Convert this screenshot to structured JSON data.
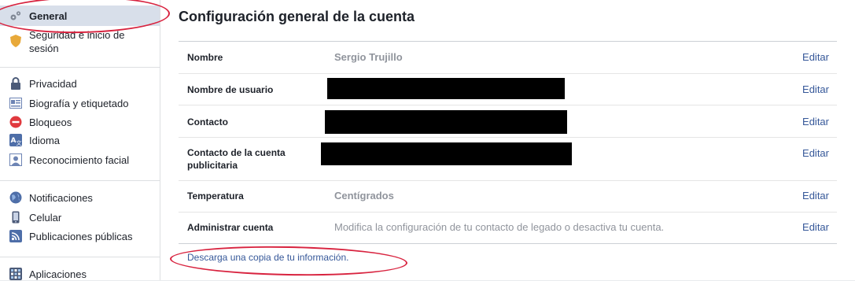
{
  "sidebar": {
    "items": [
      {
        "label": "General",
        "icon": "gear-icon"
      },
      {
        "label": "Seguridad e inicio de sesión",
        "icon": "shield-icon"
      },
      {
        "label": "Privacidad",
        "icon": "lock-icon"
      },
      {
        "label": "Biografía y etiquetado",
        "icon": "timeline-icon"
      },
      {
        "label": "Bloqueos",
        "icon": "block-icon"
      },
      {
        "label": "Idioma",
        "icon": "language-icon"
      },
      {
        "label": "Reconocimiento facial",
        "icon": "face-recognition-icon"
      },
      {
        "label": "Notificaciones",
        "icon": "globe-icon"
      },
      {
        "label": "Celular",
        "icon": "phone-icon"
      },
      {
        "label": "Publicaciones públicas",
        "icon": "rss-icon"
      },
      {
        "label": "Aplicaciones",
        "icon": "apps-icon"
      }
    ]
  },
  "main": {
    "title": "Configuración general de la cuenta",
    "rows": [
      {
        "label": "Nombre",
        "value": "Sergio Trujillo",
        "edit": "Editar"
      },
      {
        "label": "Nombre de usuario",
        "value": "",
        "edit": "Editar"
      },
      {
        "label": "Contacto",
        "value": "",
        "edit": "Editar"
      },
      {
        "label": "Contacto de la cuenta publicitaria",
        "value": "",
        "edit": "Editar"
      },
      {
        "label": "Temperatura",
        "value": "Centígrados",
        "edit": "Editar"
      },
      {
        "label": "Administrar cuenta",
        "value": "Modifica la configuración de tu contacto de legado o desactiva tu cuenta.",
        "edit": "Editar"
      }
    ],
    "download": {
      "prefix": "Descarga una ",
      "link": "copia",
      "suffix": " de tu información."
    }
  },
  "colors": {
    "accent": "#365899",
    "annotation": "#d8233f",
    "active_bg": "#d8dfea"
  }
}
